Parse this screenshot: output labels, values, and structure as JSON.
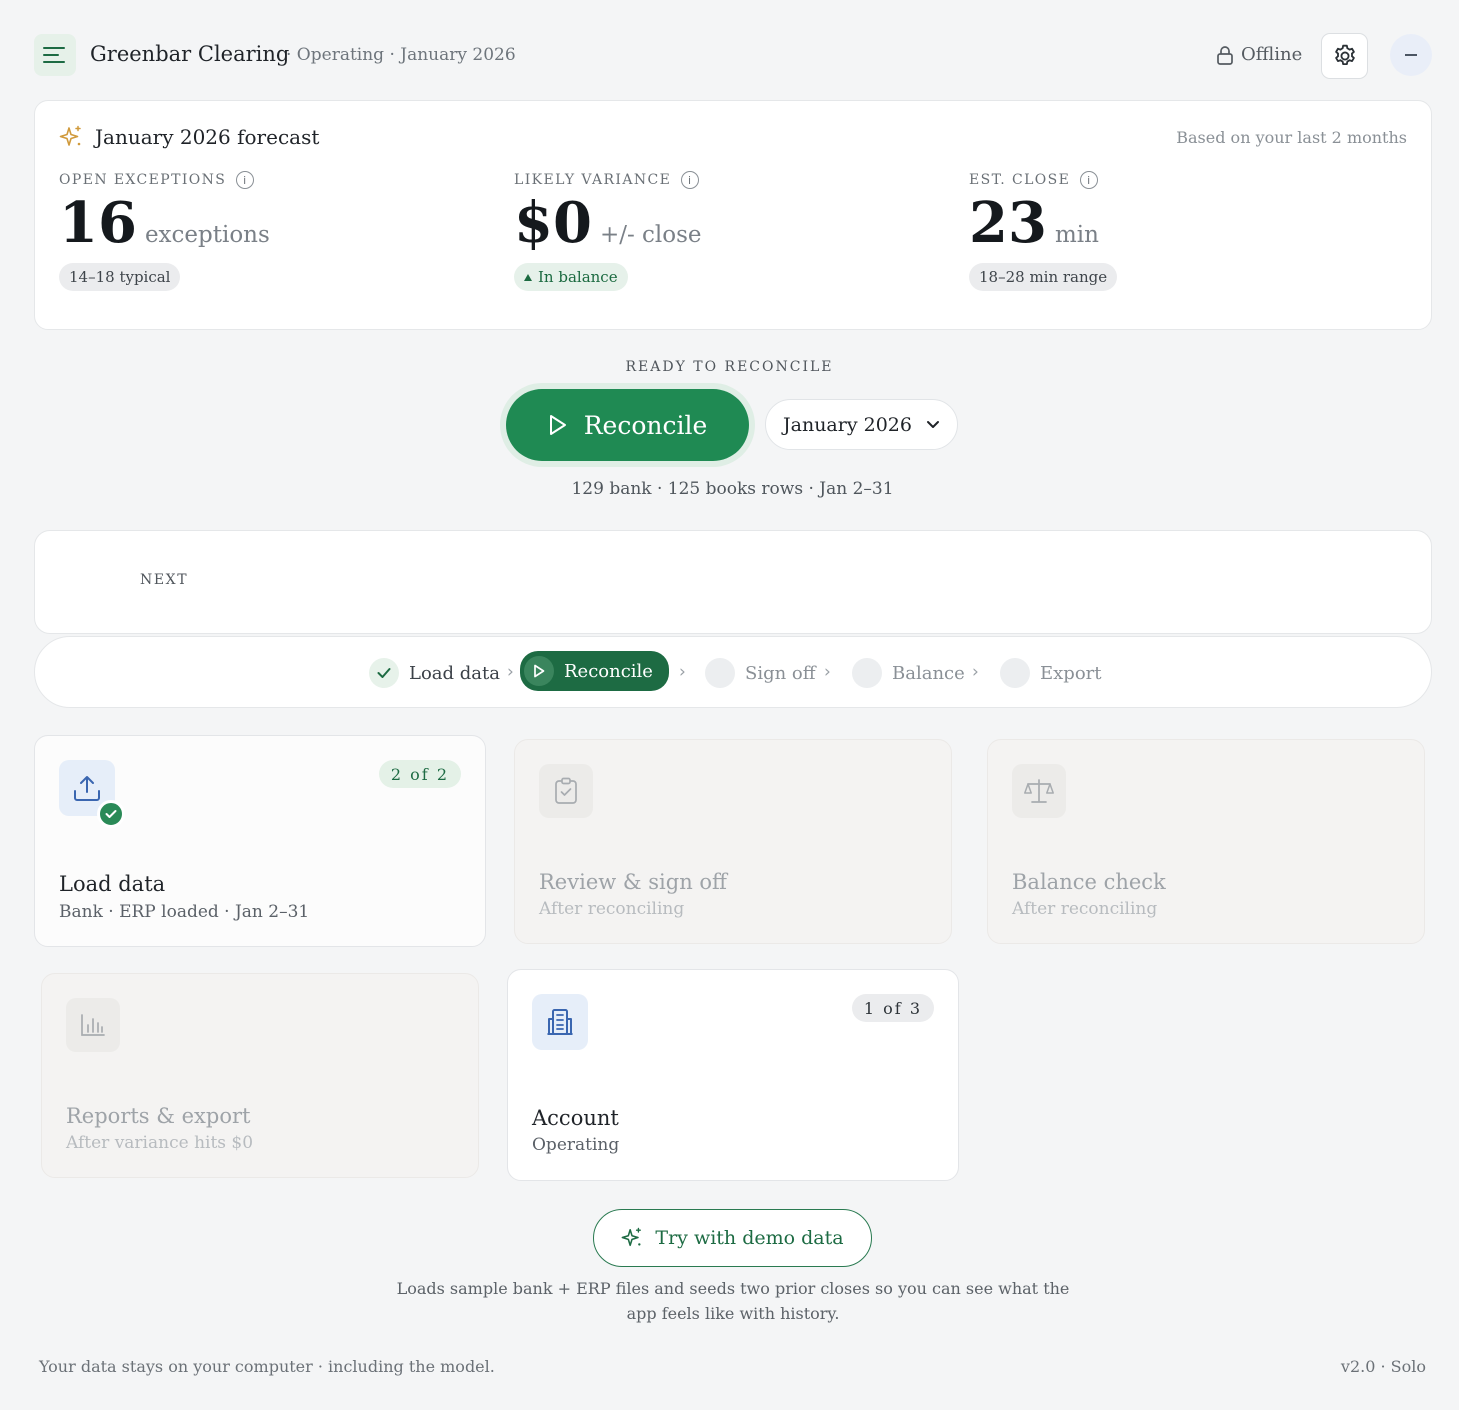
{
  "header": {
    "company": "Greenbar Clearing",
    "context": "· Operating · January 2026",
    "status": "Offline",
    "avatar_symbol": "–",
    "accent_color": "#1f8a53"
  },
  "forecast": {
    "title": "January 2026 forecast",
    "based_on": "Based on your last 2 months",
    "metrics": [
      {
        "label": "OPEN EXCEPTIONS",
        "value": "16",
        "unit": "exceptions",
        "pill": "14–18 typical"
      },
      {
        "label": "LIKELY VARIANCE",
        "value": "$0",
        "unit": "+/- close",
        "pill": "In balance"
      },
      {
        "label": "EST. CLOSE",
        "value": "23",
        "unit": "min",
        "pill": "18–28 min range"
      }
    ],
    "info_symbol": "i"
  },
  "reconcile": {
    "ready_label": "READY TO RECONCILE",
    "button_label": "Reconcile",
    "selected_month": "January 2026",
    "rows_info": "129 bank · 125 books rows · Jan 2–31"
  },
  "next": {
    "label": "NEXT"
  },
  "stepper": {
    "steps": [
      {
        "label": "Load data",
        "state": "done"
      },
      {
        "label": "Reconcile",
        "state": "active"
      },
      {
        "label": "Sign off",
        "state": "pending"
      },
      {
        "label": "Balance",
        "state": "pending"
      },
      {
        "label": "Export",
        "state": "pending"
      }
    ],
    "separator": "›"
  },
  "tiles": [
    {
      "title": "Load data",
      "subtitle": "Bank · ERP loaded · Jan 2–31",
      "badge": "2 of 2",
      "icon": "upload-icon",
      "enabled": true
    },
    {
      "title": "Review & sign off",
      "subtitle": "After reconciling",
      "icon": "clipboard-check-icon",
      "enabled": false
    },
    {
      "title": "Balance check",
      "subtitle": "After reconciling",
      "icon": "scale-icon",
      "enabled": false
    },
    {
      "title": "Reports & export",
      "subtitle": "After variance hits $0",
      "icon": "bar-chart-icon",
      "enabled": false
    },
    {
      "title": "Account",
      "subtitle": "Operating",
      "badge": "1 of 3",
      "icon": "building-icon",
      "enabled": true
    }
  ],
  "demo": {
    "button_label": "Try with demo data",
    "note": "Loads sample bank + ERP files and seeds two prior closes so you can see what the app feels like with history."
  },
  "footer": {
    "privacy": "Your data stays on your computer · including the model.",
    "version": "v2.0 · Solo"
  }
}
